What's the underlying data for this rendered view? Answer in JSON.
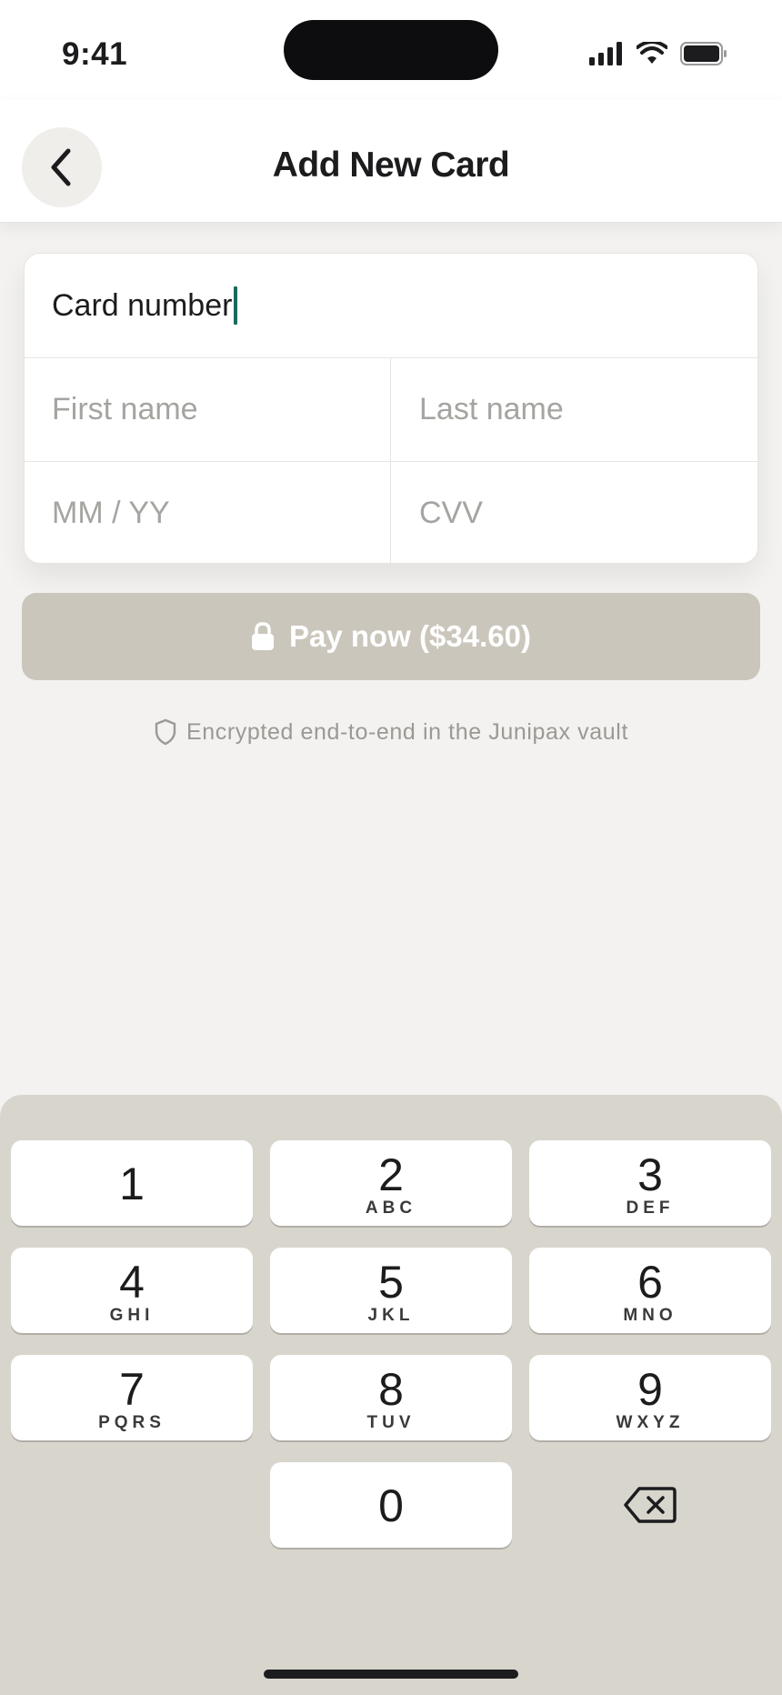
{
  "status": {
    "time": "9:41"
  },
  "header": {
    "title": "Add New Card"
  },
  "form": {
    "card_number": {
      "value": "Card number"
    },
    "first_name": {
      "placeholder": "First name"
    },
    "last_name": {
      "placeholder": "Last name"
    },
    "expiry": {
      "placeholder": "MM / YY"
    },
    "cvv": {
      "placeholder": "CVV"
    }
  },
  "pay_button": {
    "label": "Pay now ($34.60)"
  },
  "secure_note": "Encrypted end-to-end in the Junipax vault",
  "keypad": {
    "keys": [
      {
        "digit": "1",
        "letters": ""
      },
      {
        "digit": "2",
        "letters": "ABC"
      },
      {
        "digit": "3",
        "letters": "DEF"
      },
      {
        "digit": "4",
        "letters": "GHI"
      },
      {
        "digit": "5",
        "letters": "JKL"
      },
      {
        "digit": "6",
        "letters": "MNO"
      },
      {
        "digit": "7",
        "letters": "PQRS"
      },
      {
        "digit": "8",
        "letters": "TUV"
      },
      {
        "digit": "9",
        "letters": "WXYZ"
      },
      {
        "digit": "0",
        "letters": ""
      }
    ]
  },
  "colors": {
    "accent_caret": "#1a6b5c",
    "pay_button_disabled": "#cbc6bc",
    "keypad_background": "#d8d5cd"
  }
}
